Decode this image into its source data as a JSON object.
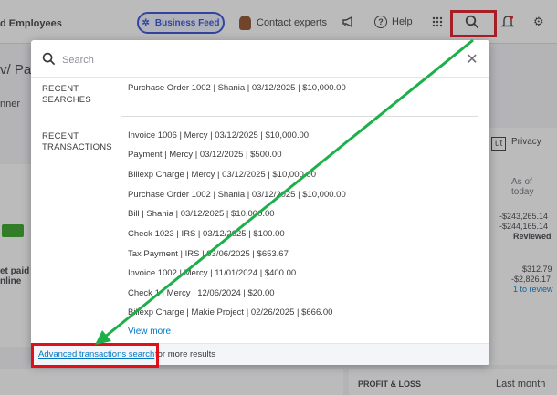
{
  "topbar": {
    "company_name": "d Employees",
    "business_feed": "Business Feed",
    "contact_experts": "Contact experts",
    "help": "Help"
  },
  "background": {
    "page_title_fragment": "v/ Pa",
    "planner_fragment": "nner",
    "out_button": "ut",
    "privacy": "Privacy",
    "as_of": "As of today",
    "amount1": "-$243,265.14",
    "amount2": "-$244,165.14",
    "reviewed": "Reviewed",
    "amount3": "$312.79",
    "amount4": "-$2,826.17",
    "to_review": "1 to review",
    "get_paid_1": "et paid",
    "get_paid_2": "nline",
    "profit_loss": "PROFIT & LOSS",
    "last_month": "Last month"
  },
  "search": {
    "placeholder": "Search",
    "recent_searches_label": "RECENT SEARCHES",
    "recent_searches": [
      "Purchase Order 1002 | Shania | 03/12/2025 | $10,000.00"
    ],
    "recent_transactions_label": "RECENT TRANSACTIONS",
    "recent_transactions": [
      "Invoice 1006 | Mercy | 03/12/2025 | $10,000.00",
      "Payment  | Mercy | 03/12/2025 | $500.00",
      "Billexp Charge  | Mercy | 03/12/2025 | $10,000.00",
      "Purchase Order 1002 | Shania | 03/12/2025 | $10,000.00",
      "Bill  | Shania | 03/12/2025 | $10,000.00",
      "Check 1023 | IRS | 03/12/2025 | $100.00",
      "Tax Payment  | IRS | 03/06/2025 | $653.67",
      "Invoice 1002 | Mercy | 11/01/2024 | $400.00",
      "Check 1 | Mercy | 12/06/2024 | $20.00",
      "Billexp Charge  | Makie Project | 02/26/2025 | $666.00"
    ],
    "view_more": "View more",
    "advanced_search": "Advanced transactions search",
    "advanced_rest": "for more results"
  },
  "colors": {
    "highlight": "#e0101a",
    "arrow": "#1db04a",
    "link": "#0077c5",
    "feed_accent": "#2c4bd3"
  }
}
